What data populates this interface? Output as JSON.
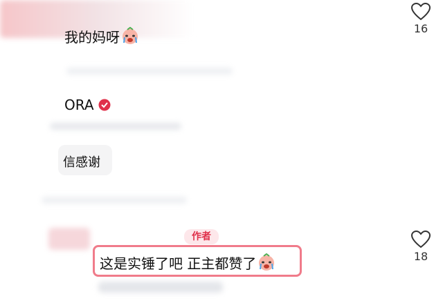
{
  "comments": [
    {
      "text": "我的妈呀",
      "emoji": "crying-face-emoji",
      "likes": "16"
    },
    {
      "text": "ORA",
      "badge": "verified-check-icon"
    },
    {
      "text": "信感谢"
    },
    {
      "author_tag": "作者",
      "text": "这是实锤了吧 正主都赞了",
      "emoji": "crying-face-emoji",
      "likes": "18"
    }
  ],
  "colors": {
    "accent": "#e0304a",
    "highlight": "#f07b8a"
  }
}
